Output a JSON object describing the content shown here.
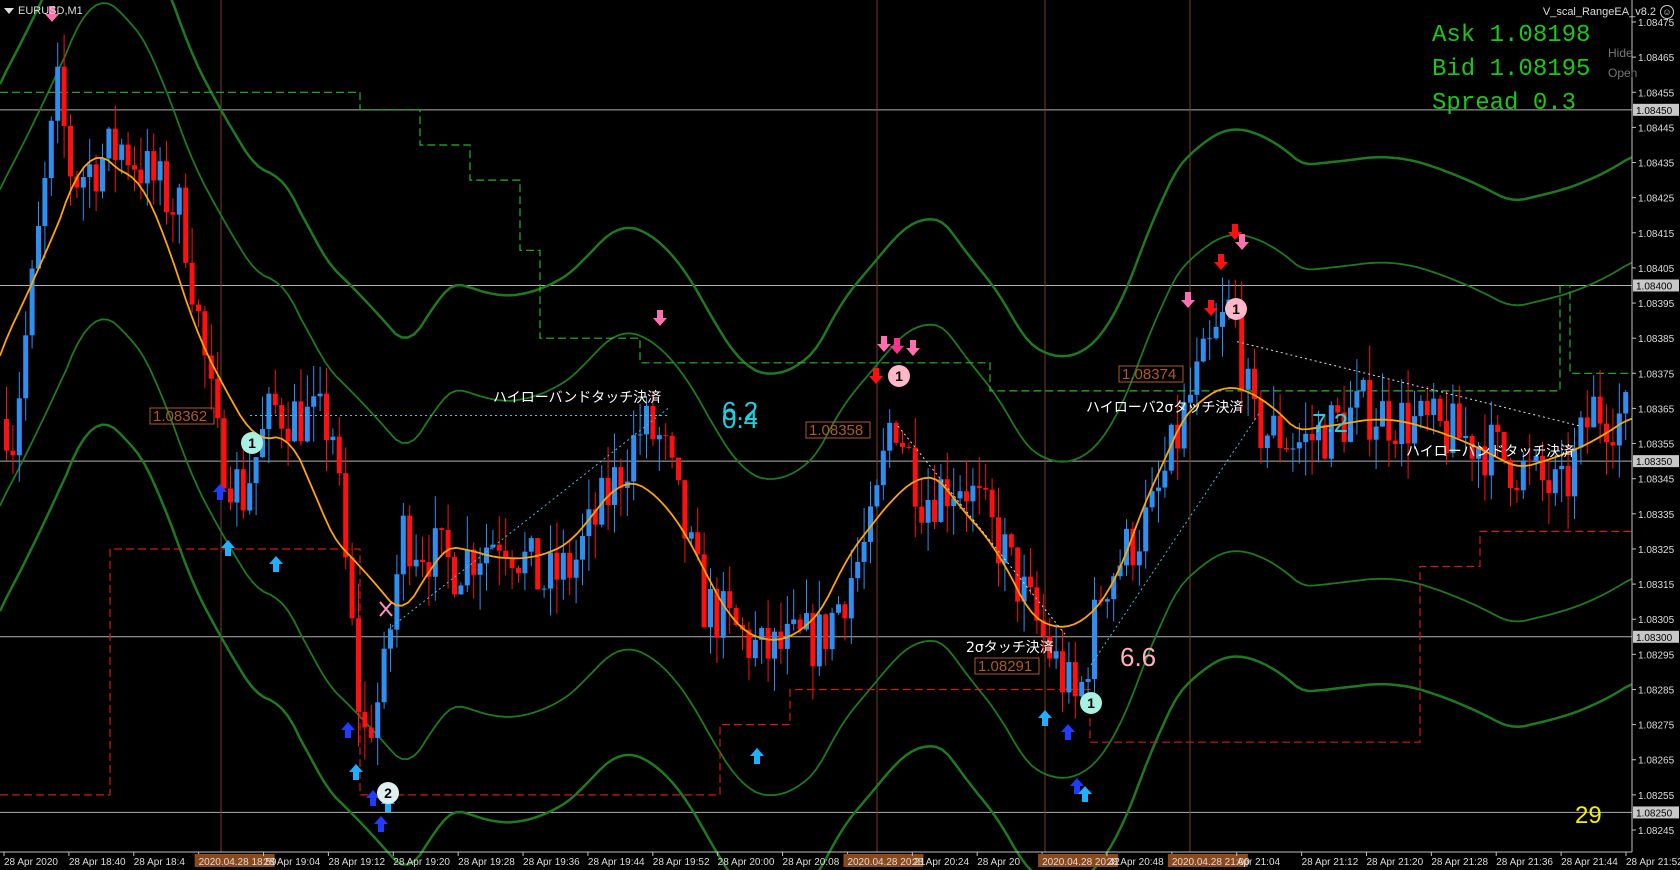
{
  "window": {
    "symbol": "EURUSD,M1",
    "ea_name": "V_scal_RangeEA_v8.2",
    "ea_icon": "smiley-icon"
  },
  "panel": {
    "ask": "Ask 1.08198",
    "bid": "Bid 1.08195",
    "spread": "Spread 0.3",
    "hide": "Hide",
    "open": "Open"
  },
  "counter": "29",
  "colors": {
    "bull": "#2f8ff0",
    "bear": "#ff1010",
    "ma": "#ffa500",
    "band": "#1f7a1f",
    "dash_green": "#28b428",
    "dash_red": "#d21818",
    "axis": "#c0c0c0",
    "session": "#7a3f1e",
    "quote_text": "#19c819",
    "counter": "#f4f000"
  },
  "price_axis": {
    "ticks": [
      "1.08475",
      "1.08465",
      "1.08455",
      "1.08445",
      "1.08435",
      "1.08425",
      "1.08415",
      "1.08405",
      "1.08395",
      "1.08385",
      "1.08375",
      "1.08365",
      "1.08355",
      "1.08345",
      "1.08335",
      "1.08325",
      "1.08315",
      "1.08305",
      "1.08295",
      "1.08285",
      "1.08275",
      "1.08265",
      "1.08255",
      "1.08245"
    ],
    "highlighted": [
      "1.08450",
      "1.08400",
      "1.08350",
      "1.08300",
      "1.08250"
    ]
  },
  "time_axis": {
    "labels": [
      "28 Apr 2020",
      "28 Apr 18:40",
      "28 Apr 18:4",
      "2020.04.28 18:59",
      "28 Apr 19:04",
      "28 Apr 19:12",
      "28 Apr 19:20",
      "28 Apr 19:28",
      "28 Apr 19:36",
      "28 Apr 19:44",
      "28 Apr 19:52",
      "28 Apr 20:00",
      "28 Apr 20:08",
      "2020.04.28 20:21",
      "28 Apr 20:24",
      "28 Apr 20",
      "2020.04.28 20:42",
      "28 Apr 20:48",
      "2020.04.28 21:00",
      "Apr 21:04",
      "28 Apr 21:12",
      "28 Apr 21:20",
      "28 Apr 21:28",
      "28 Apr 21:36",
      "28 Apr 21:44",
      "28 Apr 21:52"
    ],
    "session_labels": [
      "2020.04.28 18:59",
      "2020.04.28 20:21",
      "2020.04.28 20:42",
      "2020.04.28 21:00"
    ]
  },
  "annotations": {
    "price_tags": [
      "1.08362",
      "1.08358",
      "1.08291",
      "1.08374"
    ],
    "close_labels": [
      "ハイローバンドタッチ決済",
      "ハイローバ2σタッチ決済",
      "2σタッチ決済",
      "ハイローバンドタッチ決済"
    ],
    "numbers": [
      "6.2",
      "0.4",
      "7.2",
      "6.6"
    ],
    "markers": [
      "1",
      "2",
      "1",
      "1",
      "1"
    ]
  }
}
